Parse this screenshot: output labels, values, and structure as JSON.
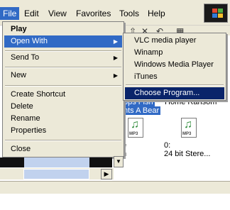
{
  "menubar": {
    "items": [
      "File",
      "Edit",
      "View",
      "Favorites",
      "Tools",
      "Help"
    ]
  },
  "background": {
    "selected_text_1": "3ps  Fish",
    "selected_text_2": "nts A Bear",
    "other_text_1": "Home Ransom",
    "file_label_left_1": "e",
    "file_label_left_2": "n",
    "file_label_right_1": "0:",
    "file_label_right_2": "24 bit Stere..."
  },
  "file_icons": [
    {
      "icon": "mp3-file-icon",
      "label": "MP3"
    },
    {
      "icon": "mp3-file-icon",
      "label": "MP3"
    }
  ],
  "context_menu": {
    "items": [
      {
        "label": "Play",
        "bold": true
      },
      {
        "label": "Open With",
        "highlighted": true,
        "submenu": true
      },
      {
        "label": "Send To",
        "submenu": true
      },
      {
        "label": "New",
        "submenu": true
      },
      {
        "label": "Create Shortcut"
      },
      {
        "label": "Delete"
      },
      {
        "label": "Rename"
      },
      {
        "label": "Properties"
      },
      {
        "label": "Close"
      }
    ]
  },
  "open_with_menu": {
    "items": [
      {
        "label": "VLC media player"
      },
      {
        "label": "Winamp"
      },
      {
        "label": "Windows Media Player"
      },
      {
        "label": "iTunes"
      },
      {
        "label": "Choose Program...",
        "highlighted": true
      }
    ]
  },
  "colors": {
    "menu_bg": "#ece9d8",
    "highlight": "#316ac5",
    "submenu_highlight": "#0a246a"
  }
}
